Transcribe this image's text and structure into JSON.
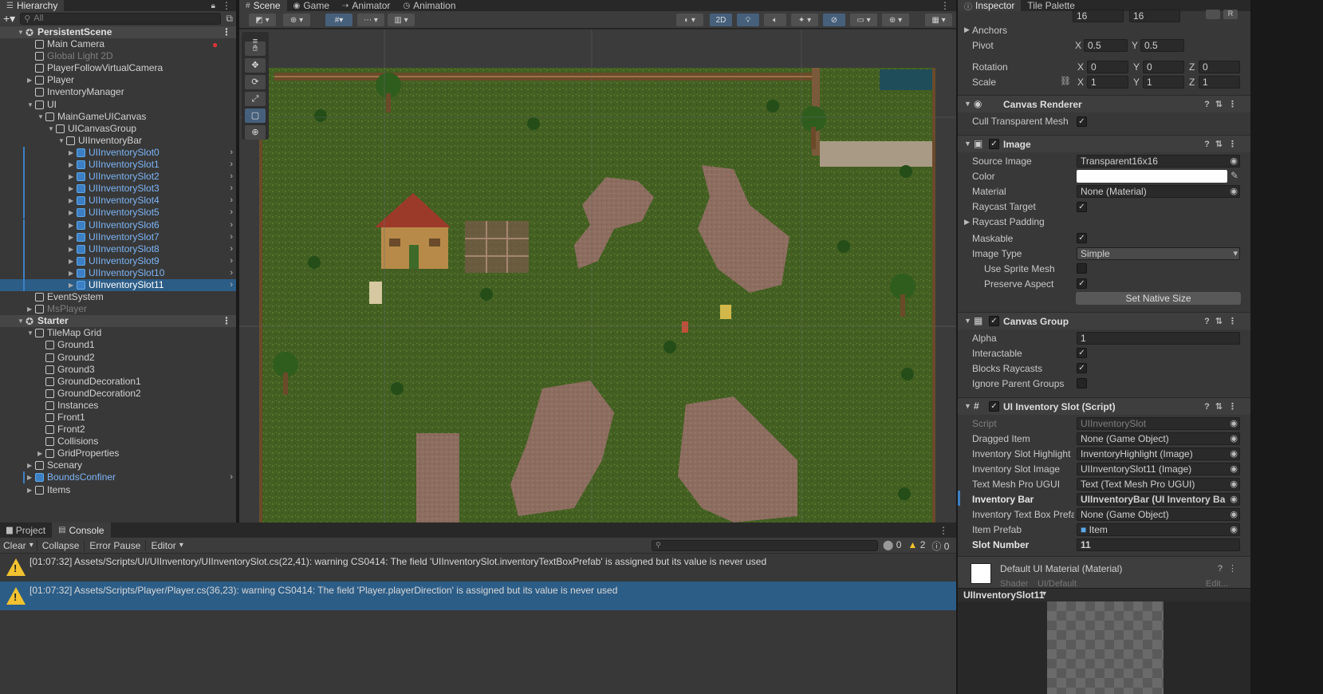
{
  "hierarchy": {
    "tab": "Hierarchy",
    "search_placeholder": "All",
    "rows": [
      {
        "label": "PersistentScene",
        "kind": "scene",
        "depth": 0,
        "expanded": true
      },
      {
        "label": "Main Camera",
        "kind": "obj",
        "depth": 1
      },
      {
        "label": "Global Light 2D",
        "kind": "dis",
        "depth": 1
      },
      {
        "label": "PlayerFollowVirtualCamera",
        "kind": "obj",
        "depth": 1
      },
      {
        "label": "Player",
        "kind": "obj",
        "depth": 1,
        "collapsed": true
      },
      {
        "label": "InventoryManager",
        "kind": "obj",
        "depth": 1
      },
      {
        "label": "UI",
        "kind": "obj",
        "depth": 1,
        "expanded": true
      },
      {
        "label": "MainGameUICanvas",
        "kind": "obj",
        "depth": 2,
        "expanded": true
      },
      {
        "label": "UICanvasGroup",
        "kind": "obj",
        "depth": 3,
        "expanded": true
      },
      {
        "label": "UIInventoryBar",
        "kind": "obj",
        "depth": 4,
        "expanded": true
      },
      {
        "label": "UIInventorySlot0",
        "kind": "pre",
        "depth": 5
      },
      {
        "label": "UIInventorySlot1",
        "kind": "pre",
        "depth": 5
      },
      {
        "label": "UIInventorySlot2",
        "kind": "pre",
        "depth": 5
      },
      {
        "label": "UIInventorySlot3",
        "kind": "pre",
        "depth": 5
      },
      {
        "label": "UIInventorySlot4",
        "kind": "pre",
        "depth": 5
      },
      {
        "label": "UIInventorySlot5",
        "kind": "pre",
        "depth": 5
      },
      {
        "label": "UIInventorySlot6",
        "kind": "pre",
        "depth": 5
      },
      {
        "label": "UIInventorySlot7",
        "kind": "pre",
        "depth": 5
      },
      {
        "label": "UIInventorySlot8",
        "kind": "pre",
        "depth": 5
      },
      {
        "label": "UIInventorySlot9",
        "kind": "pre",
        "depth": 5
      },
      {
        "label": "UIInventorySlot10",
        "kind": "pre",
        "depth": 5
      },
      {
        "label": "UIInventorySlot11",
        "kind": "sel",
        "depth": 5
      },
      {
        "label": "EventSystem",
        "kind": "obj",
        "depth": 1
      },
      {
        "label": "MsPlayer",
        "kind": "dis",
        "depth": 1,
        "collapsed": true
      },
      {
        "label": "Starter",
        "kind": "scene",
        "depth": 0,
        "expanded": true
      },
      {
        "label": "TileMap Grid",
        "kind": "obj",
        "depth": 1,
        "expanded": true
      },
      {
        "label": "Ground1",
        "kind": "obj",
        "depth": 2
      },
      {
        "label": "Ground2",
        "kind": "obj",
        "depth": 2
      },
      {
        "label": "Ground3",
        "kind": "obj",
        "depth": 2
      },
      {
        "label": "GroundDecoration1",
        "kind": "obj",
        "depth": 2
      },
      {
        "label": "GroundDecoration2",
        "kind": "obj",
        "depth": 2
      },
      {
        "label": "Instances",
        "kind": "obj",
        "depth": 2
      },
      {
        "label": "Front1",
        "kind": "obj",
        "depth": 2
      },
      {
        "label": "Front2",
        "kind": "obj",
        "depth": 2
      },
      {
        "label": "Collisions",
        "kind": "obj",
        "depth": 2
      },
      {
        "label": "GridProperties",
        "kind": "obj",
        "depth": 2,
        "collapsed": true
      },
      {
        "label": "Scenary",
        "kind": "obj",
        "depth": 1,
        "collapsed": true
      },
      {
        "label": "BoundsConfiner",
        "kind": "pre",
        "depth": 1
      },
      {
        "label": "Items",
        "kind": "obj",
        "depth": 1,
        "collapsed": true
      }
    ]
  },
  "scene_tabs": [
    "Scene",
    "Game",
    "Animator",
    "Animation"
  ],
  "scene_toolbar": {
    "mode_2d": "2D"
  },
  "inspector": {
    "tabs": [
      "Inspector",
      "Tile Palette"
    ],
    "size_values": [
      "16",
      "16"
    ],
    "anchors": "Anchors",
    "pivot": {
      "label": "Pivot",
      "x": "0.5",
      "y": "0.5"
    },
    "rotation": {
      "label": "Rotation",
      "x": "0",
      "y": "0",
      "z": "0"
    },
    "scale": {
      "label": "Scale",
      "x": "1",
      "y": "1",
      "z": "1"
    },
    "canvas_renderer": {
      "title": "Canvas Renderer",
      "cull_label": "Cull Transparent Mesh"
    },
    "image": {
      "title": "Image",
      "source_image_label": "Source Image",
      "source_image": "Transparent16x16",
      "color_label": "Color",
      "material_label": "Material",
      "material": "None (Material)",
      "raycast_target_label": "Raycast Target",
      "raycast_padding_label": "Raycast Padding",
      "maskable_label": "Maskable",
      "image_type_label": "Image Type",
      "image_type": "Simple",
      "use_sprite_mesh_label": "Use Sprite Mesh",
      "preserve_aspect_label": "Preserve Aspect",
      "set_native_size": "Set Native Size"
    },
    "canvas_group": {
      "title": "Canvas Group",
      "alpha_label": "Alpha",
      "alpha": "1",
      "interactable_label": "Interactable",
      "blocks_raycasts_label": "Blocks Raycasts",
      "ignore_parent_label": "Ignore Parent Groups"
    },
    "slot_script": {
      "title": "UI Inventory Slot (Script)",
      "script_label": "Script",
      "script": "UIInventorySlot",
      "dragged_item_label": "Dragged Item",
      "dragged_item": "None (Game Object)",
      "highlight_label": "Inventory Slot Highlight",
      "highlight": "InventoryHighlight (Image)",
      "slot_image_label": "Inventory Slot Image",
      "slot_image": "UIInventorySlot11 (Image)",
      "tmp_label": "Text Mesh Pro UGUI",
      "tmp": "Text (Text Mesh Pro UGUI)",
      "bar_label": "Inventory Bar",
      "bar": "UIInventoryBar (UI Inventory Ba",
      "textbox_label": "Inventory Text Box Prefa",
      "textbox": "None (Game Object)",
      "prefab_label": "Item Prefab",
      "prefab": "Item",
      "slot_number_label": "Slot Number",
      "slot_number": "11"
    },
    "material_section": {
      "title": "Default UI Material (Material)",
      "shader": "Shader",
      "shader_value": "UI/Default",
      "edit": "Edit..."
    },
    "preview_title": "UIInventorySlot11"
  },
  "console": {
    "tabs": [
      "Project",
      "Console"
    ],
    "clear": "Clear",
    "collapse": "Collapse",
    "error_pause": "Error Pause",
    "editor": "Editor",
    "counts": {
      "errors": "0",
      "warnings": "2",
      "infos": "0"
    },
    "messages": [
      "[01:07:32] Assets/Scripts/UI/UIInventory/UIInventorySlot.cs(22,41): warning CS0414: The field 'UIInventorySlot.inventoryTextBoxPrefab' is assigned but its value is never used",
      "[01:07:32] Assets/Scripts/Player/Player.cs(36,23): warning CS0414: The field 'Player.playerDirection' is assigned but its value is never used"
    ]
  },
  "colors": {
    "selection": "#2c5d87",
    "prefab_text": "#7cb4f5",
    "grass": "#3d5a1e",
    "dirt": "#8a6a5c",
    "warning": "#f2c230"
  }
}
